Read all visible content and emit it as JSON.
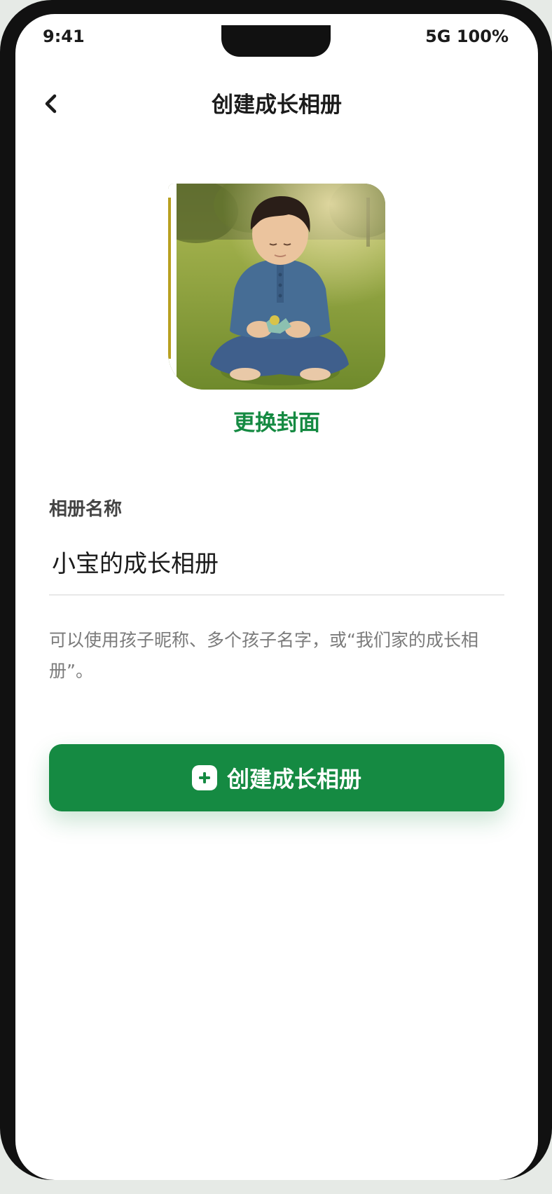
{
  "status_bar": {
    "time": "9:41",
    "network_battery": "5G 100%"
  },
  "header": {
    "title": "创建成长相册",
    "back_icon": "chevron-left-icon"
  },
  "cover": {
    "change_label": "更换封面"
  },
  "form": {
    "name_label": "相册名称",
    "name_value": "小宝的成长相册",
    "hint": "可以使用孩子昵称、多个孩子名字，或“我们家的成长相册”。"
  },
  "actions": {
    "create_label": "创建成长相册",
    "create_icon": "plus-square-icon"
  },
  "colors": {
    "accent": "#158a42",
    "text": "#1b1b1b",
    "hint": "#7b7b7b"
  }
}
